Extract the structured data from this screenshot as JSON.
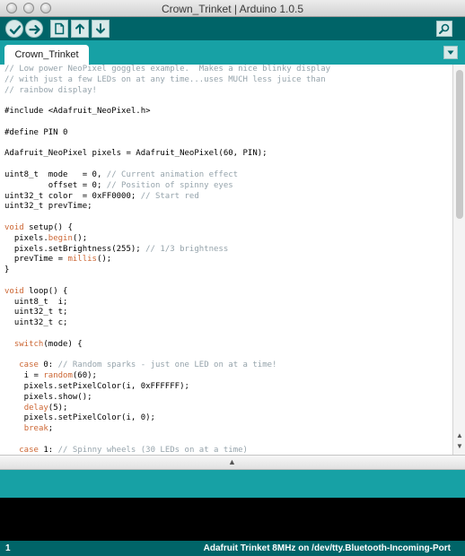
{
  "window": {
    "title": "Crown_Trinket | Arduino 1.0.5"
  },
  "toolbar": {
    "buttons": [
      {
        "icon": "verify-check-icon"
      },
      {
        "icon": "upload-arrow-icon"
      },
      {
        "icon": "new-file-icon"
      },
      {
        "icon": "open-arrow-up-icon"
      },
      {
        "icon": "save-arrow-down-icon"
      }
    ],
    "serial_monitor_icon": "magnifier-icon",
    "colors": {
      "toolbar": "#006468",
      "tabstrip": "#17a1a5",
      "buttons": "#d9e9e9"
    }
  },
  "tabs": [
    {
      "label": "Crown_Trinket"
    }
  ],
  "editor": {
    "lines": [
      "// Low power NeoPixel goggles example.  Makes a nice blinky display",
      "// with just a few LEDs on at any time...uses MUCH less juice than",
      "// rainbow display!",
      "",
      "#include <Adafruit_NeoPixel.h>",
      "",
      "#define PIN 0",
      "",
      "Adafruit_NeoPixel pixels = Adafruit_NeoPixel(60, PIN);",
      "",
      "uint8_t  mode   = 0, // Current animation effect",
      "         offset = 0; // Position of spinny eyes",
      "uint32_t color  = 0xFF0000; // Start red",
      "uint32_t prevTime;",
      "",
      "void setup() {",
      "  pixels.begin();",
      "  pixels.setBrightness(255); // 1/3 brightness",
      "  prevTime = millis();",
      "}",
      "",
      "void loop() {",
      "  uint8_t  i;",
      "  uint32_t t;",
      "  uint32_t c;",
      "",
      "  switch(mode) {",
      "",
      "   case 0: // Random sparks - just one LED on at a time!",
      "    i = random(60);",
      "    pixels.setPixelColor(i, 0xFFFFFF);",
      "    pixels.show();",
      "    delay(5);",
      "    pixels.setPixelColor(i, 0);",
      "    break;",
      "",
      "   case 1: // Spinny wheels (30 LEDs on at a time)"
    ]
  },
  "footer": {
    "line_number": "1",
    "board_port": "Adafruit Trinket 8MHz on /dev/tty.Bluetooth-Incoming-Port"
  }
}
